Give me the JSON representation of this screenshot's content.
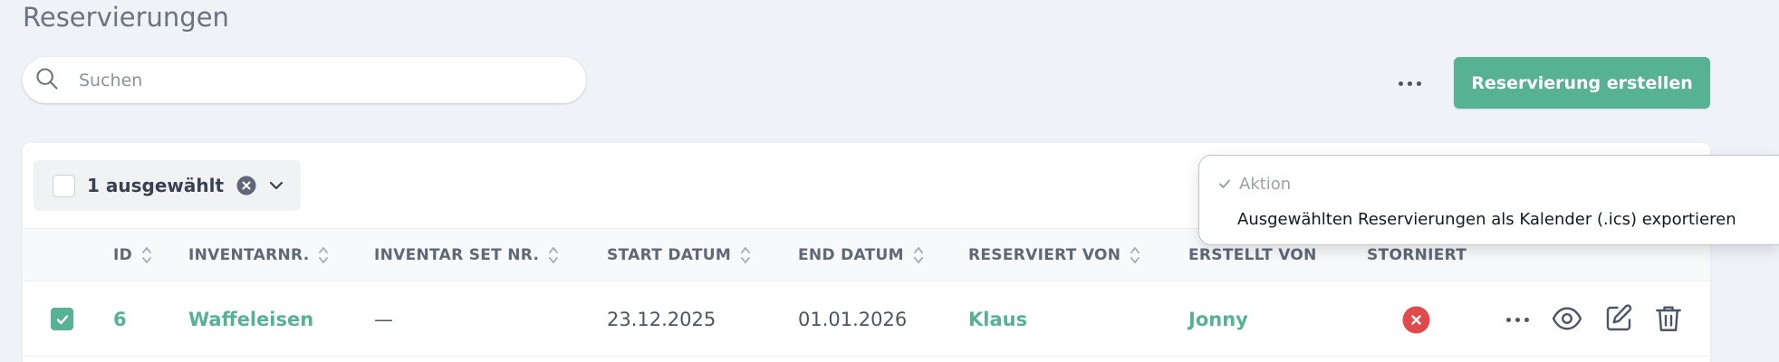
{
  "page": {
    "title": "Reservierungen"
  },
  "search": {
    "placeholder": "Suchen",
    "value": ""
  },
  "toolbar": {
    "create_label": "Reservierung erstellen"
  },
  "selection": {
    "label": "1 ausgewählt"
  },
  "table": {
    "columns": [
      "ID",
      "INVENTARNR.",
      "INVENTAR SET NR.",
      "START DATUM",
      "END DATUM",
      "RESERVIERT VON",
      "ERSTELLT VON",
      "STORNIERT"
    ],
    "rows": [
      {
        "selected": true,
        "id": "6",
        "inventarnr": "Waffeleisen",
        "inventar_set_nr": "—",
        "start_datum": "23.12.2025",
        "end_datum": "01.01.2026",
        "reserviert_von": "Klaus",
        "erstellt_von": "Jonny",
        "storniert": false
      }
    ]
  },
  "action_menu": {
    "header": "Aktion",
    "items": [
      "Ausgewählten Reservierungen als Kalender (.ics) exportieren"
    ]
  },
  "colors": {
    "accent": "#57b294",
    "danger": "#e04a4a",
    "background": "#eff2f7"
  },
  "icons": {
    "search": "search-icon",
    "more": "more-horizontal-icon",
    "clear": "close-circle-icon",
    "chevron": "chevron-down-icon",
    "sort": "sort-icon",
    "cancelled": "close-circle-red-icon",
    "view": "eye-icon",
    "edit": "edit-icon",
    "delete": "trash-icon",
    "check": "check-icon"
  }
}
